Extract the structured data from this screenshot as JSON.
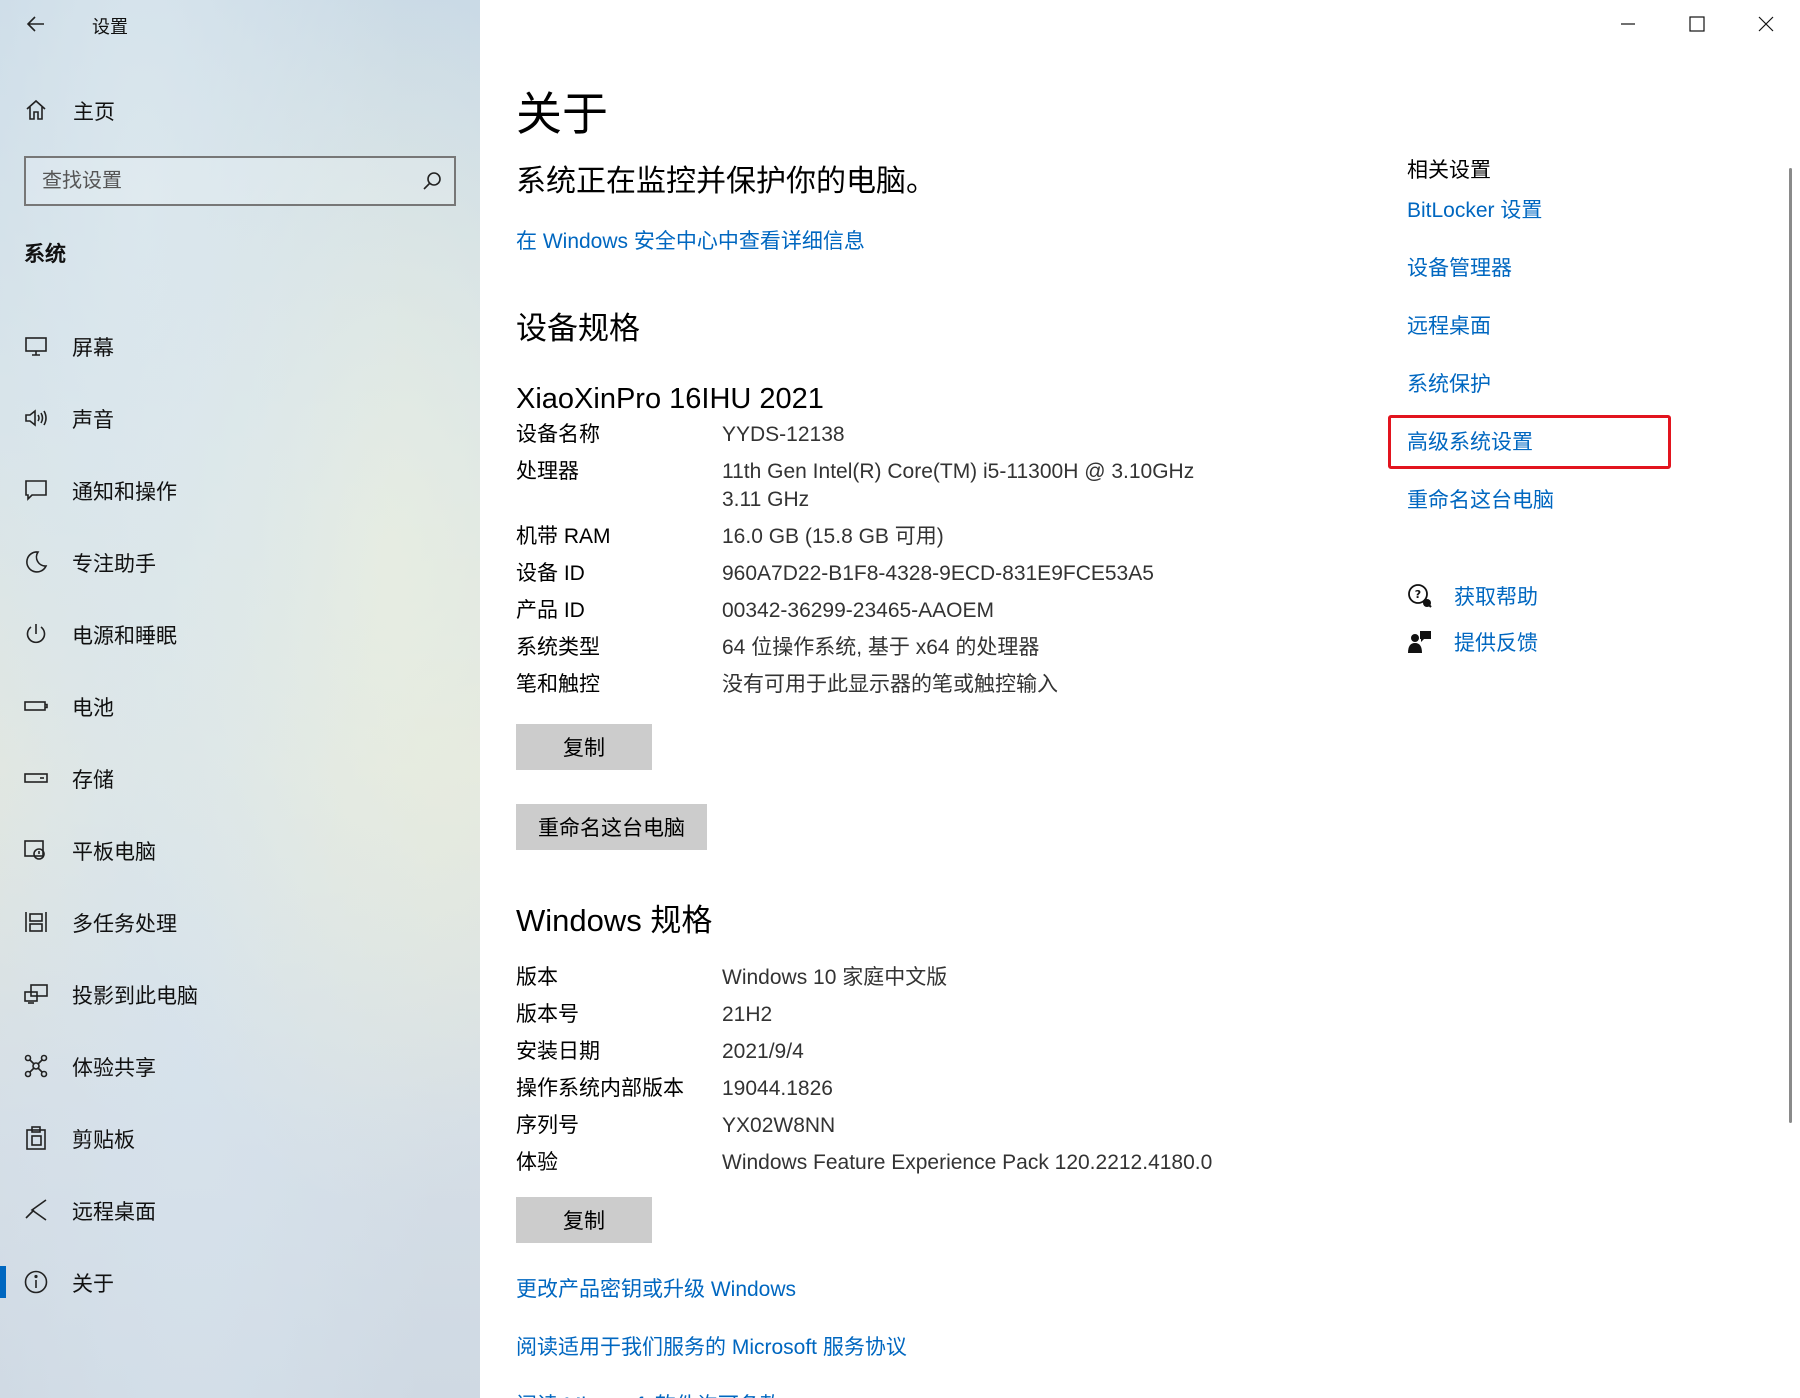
{
  "window": {
    "app_title": "设置",
    "controls": [
      "minimize",
      "maximize",
      "close"
    ]
  },
  "sidebar": {
    "home_label": "主页",
    "search_placeholder": "查找设置",
    "section_title": "系统",
    "items": [
      {
        "label": "屏幕",
        "icon": "monitor-icon"
      },
      {
        "label": "声音",
        "icon": "speaker-icon"
      },
      {
        "label": "通知和操作",
        "icon": "notification-icon"
      },
      {
        "label": "专注助手",
        "icon": "moon-icon"
      },
      {
        "label": "电源和睡眠",
        "icon": "power-icon"
      },
      {
        "label": "电池",
        "icon": "battery-icon"
      },
      {
        "label": "存储",
        "icon": "storage-icon"
      },
      {
        "label": "平板电脑",
        "icon": "tablet-icon"
      },
      {
        "label": "多任务处理",
        "icon": "multitask-icon"
      },
      {
        "label": "投影到此电脑",
        "icon": "project-icon"
      },
      {
        "label": "体验共享",
        "icon": "share-icon"
      },
      {
        "label": "剪贴板",
        "icon": "clipboard-icon"
      },
      {
        "label": "远程桌面",
        "icon": "remote-icon"
      },
      {
        "label": "关于",
        "icon": "info-icon",
        "active": true
      }
    ]
  },
  "main": {
    "title": "关于",
    "protect_text": "系统正在监控并保护你的电脑。",
    "security_link": "在 Windows 安全中心中查看详细信息",
    "device_specs_title": "设备规格",
    "device_model": "XiaoXinPro 16IHU 2021",
    "device_specs": [
      {
        "key": "设备名称",
        "value": "YYDS-12138"
      },
      {
        "key": "处理器",
        "value": "11th Gen Intel(R) Core(TM) i5-11300H @ 3.10GHz\n3.11 GHz"
      },
      {
        "key": "机带 RAM",
        "value": "16.0 GB (15.8 GB 可用)"
      },
      {
        "key": "设备 ID",
        "value": "960A7D22-B1F8-4328-9ECD-831E9FCE53A5"
      },
      {
        "key": "产品 ID",
        "value": "00342-36299-23465-AAOEM"
      },
      {
        "key": "系统类型",
        "value": "64 位操作系统, 基于 x64 的处理器"
      },
      {
        "key": "笔和触控",
        "value": "没有可用于此显示器的笔或触控输入"
      }
    ],
    "copy_button": "复制",
    "rename_button": "重命名这台电脑",
    "windows_specs_title": "Windows 规格",
    "windows_specs": [
      {
        "key": "版本",
        "value": "Windows 10 家庭中文版"
      },
      {
        "key": "版本号",
        "value": "21H2"
      },
      {
        "key": "安装日期",
        "value": "2021/9/4"
      },
      {
        "key": "操作系统内部版本",
        "value": "19044.1826"
      },
      {
        "key": "序列号",
        "value": "YX02W8NN"
      },
      {
        "key": "体验",
        "value": "Windows Feature Experience Pack 120.2212.4180.0"
      }
    ],
    "copy_button_2": "复制",
    "links": [
      "更改产品密钥或升级 Windows",
      "阅读适用于我们服务的 Microsoft 服务协议",
      "阅读 Microsoft 软件许可条款"
    ]
  },
  "related": {
    "title": "相关设置",
    "links": [
      "BitLocker 设置",
      "设备管理器",
      "远程桌面",
      "系统保护",
      "高级系统设置",
      "重命名这台电脑"
    ],
    "highlighted": "高级系统设置",
    "help": [
      {
        "label": "获取帮助",
        "icon": "help-chat-icon"
      },
      {
        "label": "提供反馈",
        "icon": "feedback-icon"
      }
    ]
  },
  "colors": {
    "accent": "#0067c0",
    "highlight_border": "#e2141e",
    "button_bg": "#cccccc"
  }
}
